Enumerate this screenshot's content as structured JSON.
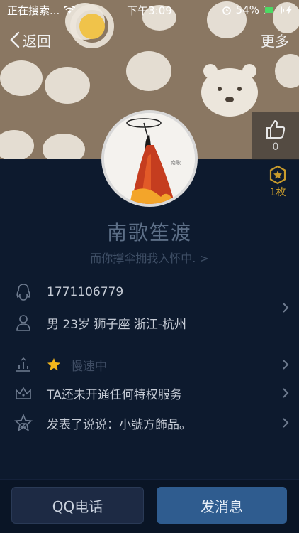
{
  "status_bar": {
    "carrier": "正在搜索...",
    "time": "下午3:09",
    "battery": "54%",
    "battery_level": 0.54
  },
  "nav": {
    "back_label": "返回",
    "more_label": "更多"
  },
  "likes": {
    "count": "0"
  },
  "medal": {
    "count": "1枚"
  },
  "profile": {
    "nickname": "南歌笙渡",
    "signature": "而你撑伞拥我入怀中. >",
    "avatar_caption": "南歌"
  },
  "info": {
    "qq_number": "1771106779",
    "details": "男  23岁  狮子座  浙江-杭州",
    "level": "慢速中",
    "privilege": "TA还未开通任何特权服务",
    "feed": "发表了说说：小號方飾品。"
  },
  "actions": {
    "call_label": "QQ电话",
    "message_label": "发消息"
  },
  "colors": {
    "background": "#0d1a2e",
    "accent_gold": "#c89b2c",
    "button_primary": "#2f5c8f"
  }
}
